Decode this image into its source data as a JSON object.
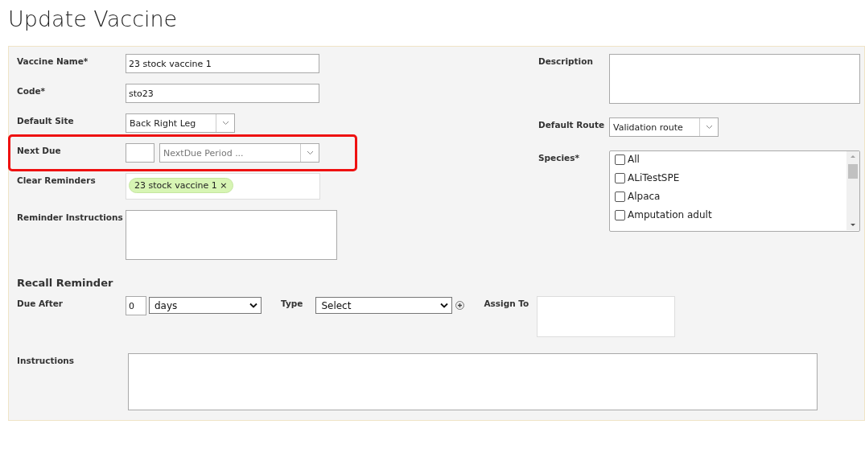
{
  "page_title": "Update Vaccine",
  "left_fields": [
    {
      "kind": "text",
      "label": "Vaccine Name*",
      "value": "23 stock vaccine 1",
      "highlighted": false
    },
    {
      "kind": "text",
      "label": "Code*",
      "value": "sto23",
      "highlighted": false
    },
    {
      "kind": "select",
      "label": "Default Site",
      "value": "Back Right Leg",
      "highlighted": false
    },
    {
      "kind": "period",
      "label": "Next Due",
      "placeholder": "NextDue Period ...",
      "highlighted": true
    },
    {
      "kind": "tags",
      "label": "Clear Reminders",
      "tags": [
        {
          "label": "23 stock vaccine 1",
          "remove": "×"
        }
      ],
      "highlighted": false
    },
    {
      "kind": "textarea",
      "label": "Reminder Instructions",
      "highlighted": false
    }
  ],
  "right_fields": [
    {
      "kind": "textarea",
      "label": "Description"
    },
    {
      "kind": "select",
      "label": "Default Route",
      "value": "Validation route"
    },
    {
      "kind": "checklist",
      "label": "Species*",
      "items": [
        {
          "label": "All",
          "checked": false
        },
        {
          "label": "ALiTestSPE",
          "checked": false
        },
        {
          "label": "Alpaca",
          "checked": false
        },
        {
          "label": "Amputation adult",
          "checked": false
        }
      ]
    }
  ],
  "recall": {
    "heading": "Recall Reminder",
    "due_after_label": "Due After",
    "due_after_value": "0",
    "due_after_unit": "days",
    "type_label": "Type",
    "type_value": "Select",
    "assign_to_label": "Assign To",
    "instructions_label": "Instructions"
  }
}
